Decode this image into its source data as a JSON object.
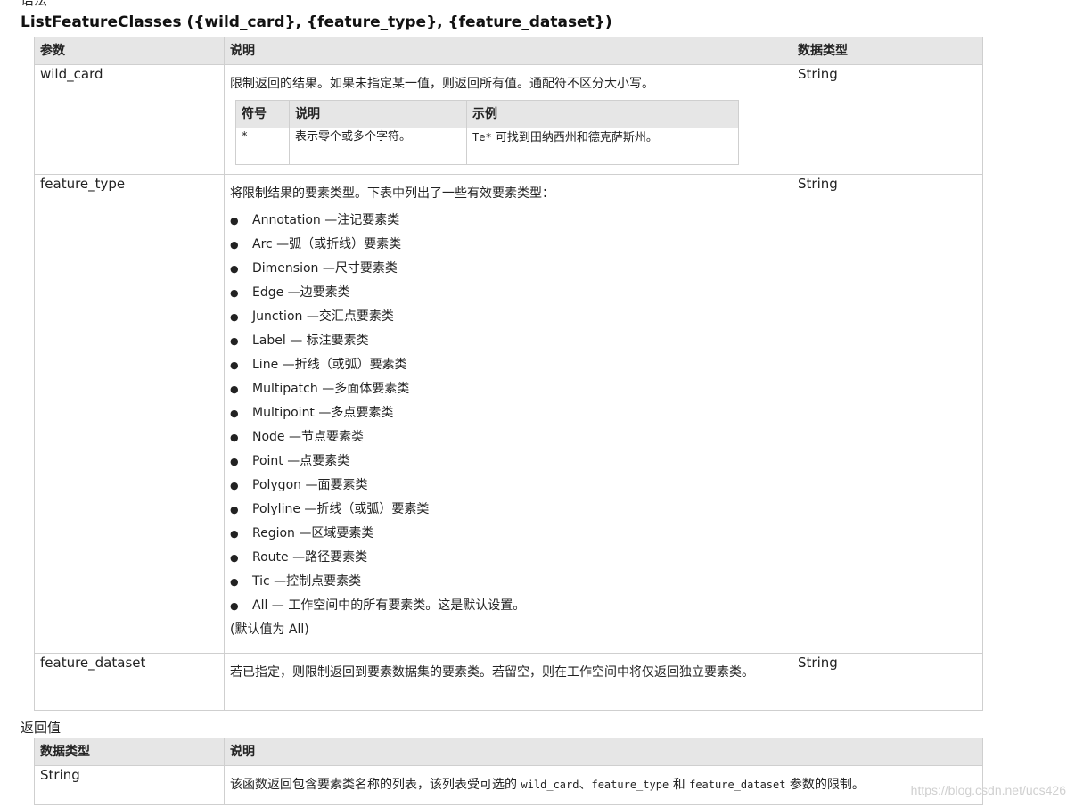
{
  "syntax_heading": "语法",
  "signature": "ListFeatureClasses ({wild_card}, {feature_type}, {feature_dataset})",
  "params_table": {
    "headers": [
      "参数",
      "说明",
      "数据类型"
    ],
    "rows": [
      {
        "name": "wild_card",
        "description": "限制返回的结果。如果未指定某一值，则返回所有值。通配符不区分大小写。",
        "type": "String",
        "inner_table": {
          "headers": [
            "符号",
            "说明",
            "示例"
          ],
          "row": {
            "symbol": "*",
            "explanation": "表示零个或多个字符。",
            "example_code": "Te*",
            "example_text": " 可找到田纳西州和德克萨斯州。"
          }
        }
      },
      {
        "name": "feature_type",
        "description": "将限制结果的要素类型。下表中列出了一些有效要素类型：",
        "type": "String",
        "bullet": "●",
        "items": [
          "Annotation —注记要素类",
          "Arc —弧（或折线）要素类",
          "Dimension —尺寸要素类",
          "Edge —边要素类",
          "Junction —交汇点要素类",
          "Label — 标注要素类",
          "Line —折线（或弧）要素类",
          "Multipatch —多面体要素类",
          "Multipoint —多点要素类",
          "Node —节点要素类",
          "Point —点要素类",
          "Polygon —面要素类",
          "Polyline —折线（或弧）要素类",
          "Region —区域要素类",
          "Route —路径要素类",
          "Tic —控制点要素类",
          "All — 工作空间中的所有要素类。这是默认设置。"
        ],
        "default_note": "(默认值为 All)"
      },
      {
        "name": "feature_dataset",
        "description": "若已指定，则限制返回到要素数据集的要素类。若留空，则在工作空间中将仅返回独立要素类。",
        "type": "String"
      }
    ]
  },
  "returns_heading": "返回值",
  "returns_table": {
    "headers": [
      "数据类型",
      "说明"
    ],
    "row": {
      "type": "String",
      "desc_parts": [
        "该函数返回包含要素类名称的列表，该列表受可选的 ",
        "wild_card",
        "、",
        "feature_type",
        " 和 ",
        "feature_dataset",
        " 参数的限制。"
      ]
    }
  },
  "watermark": "https://blog.csdn.net/ucs426"
}
